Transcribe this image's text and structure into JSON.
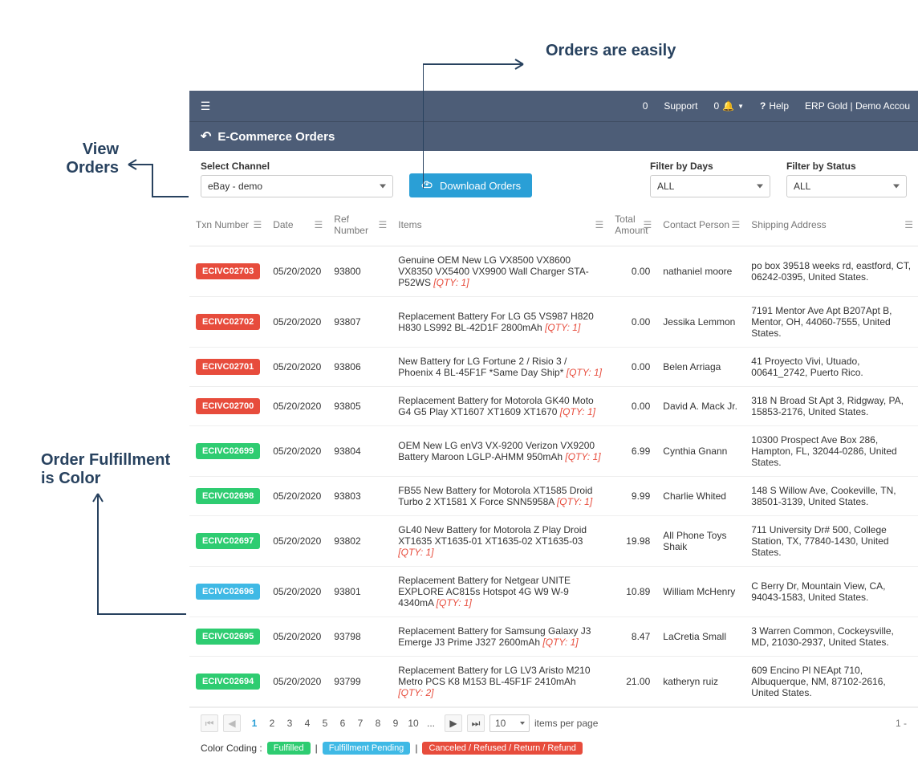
{
  "annotations": {
    "orders_easily": "Orders are easily",
    "view_orders_l1": "View",
    "view_orders_l2": "Orders",
    "order_fulfillment_l1": "Order Fulfillment",
    "order_fulfillment_l2": "is Color"
  },
  "topbar": {
    "count1": "0",
    "support": "Support",
    "count2": "0",
    "help": "Help",
    "account": "ERP Gold | Demo Accou"
  },
  "page": {
    "title": "E-Commerce Orders"
  },
  "filters": {
    "channel_label": "Select Channel",
    "channel_value": "eBay - demo",
    "download_label": "Download Orders",
    "days_label": "Filter by Days",
    "days_value": "ALL",
    "status_label": "Filter by Status",
    "status_value": "ALL"
  },
  "headers": {
    "txn": "Txn Number",
    "date": "Date",
    "ref": "Ref Number",
    "items": "Items",
    "amount": "Total Amount",
    "contact": "Contact Person",
    "addr": "Shipping Address"
  },
  "rows": [
    {
      "txn": "ECIVC02703",
      "status": "red",
      "date": "05/20/2020",
      "ref": "93800",
      "item": "Genuine OEM New LG VX8500 VX8600 VX8350 VX5400 VX9900 Wall Charger STA-P52WS",
      "qty": "[QTY: 1]",
      "amount": "0.00",
      "contact": "nathaniel moore",
      "addr": "po box 39518 weeks rd, eastford, CT, 06242-0395, United States."
    },
    {
      "txn": "ECIVC02702",
      "status": "red",
      "date": "05/20/2020",
      "ref": "93807",
      "item": "Replacement Battery For LG G5 VS987 H820 H830 LS992 BL-42D1F 2800mAh",
      "qty": "[QTY: 1]",
      "amount": "0.00",
      "contact": "Jessika Lemmon",
      "addr": "7191 Mentor Ave Apt B207Apt B, Mentor, OH, 44060-7555, United States."
    },
    {
      "txn": "ECIVC02701",
      "status": "red",
      "date": "05/20/2020",
      "ref": "93806",
      "item": "New Battery for LG Fortune 2 / Risio 3 / Phoenix 4 BL-45F1F *Same Day Ship*",
      "qty": "[QTY: 1]",
      "amount": "0.00",
      "contact": "Belen Arriaga",
      "addr": "41 Proyecto Vivi, Utuado, 00641_2742, Puerto Rico."
    },
    {
      "txn": "ECIVC02700",
      "status": "red",
      "date": "05/20/2020",
      "ref": "93805",
      "item": "Replacement Battery for Motorola GK40 Moto G4 G5 Play XT1607 XT1609 XT1670",
      "qty": "[QTY: 1]",
      "amount": "0.00",
      "contact": "David A. Mack Jr.",
      "addr": "318 N Broad St Apt 3, Ridgway, PA, 15853-2176, United States."
    },
    {
      "txn": "ECIVC02699",
      "status": "green",
      "date": "05/20/2020",
      "ref": "93804",
      "item": "OEM New LG enV3 VX-9200 Verizon VX9200 Battery Maroon LGLP-AHMM 950mAh",
      "qty": "[QTY: 1]",
      "amount": "6.99",
      "contact": "Cynthia Gnann",
      "addr": "10300 Prospect Ave Box 286, Hampton, FL, 32044-0286, United States."
    },
    {
      "txn": "ECIVC02698",
      "status": "green",
      "date": "05/20/2020",
      "ref": "93803",
      "item": "FB55 New Battery for Motorola XT1585 Droid Turbo 2 XT1581 X Force SNN5958A",
      "qty": "[QTY: 1]",
      "amount": "9.99",
      "contact": "Charlie Whited",
      "addr": "148 S Willow Ave, Cookeville, TN, 38501-3139, United States."
    },
    {
      "txn": "ECIVC02697",
      "status": "green",
      "date": "05/20/2020",
      "ref": "93802",
      "item": "GL40 New Battery for Motorola Z Play Droid XT1635 XT1635-01 XT1635-02 XT1635-03",
      "qty": "[QTY: 1]",
      "amount": "19.98",
      "contact": "All Phone Toys Shaik",
      "addr": "711 University Dr# 500, College Station, TX, 77840-1430, United States."
    },
    {
      "txn": "ECIVC02696",
      "status": "blue",
      "date": "05/20/2020",
      "ref": "93801",
      "item": "Replacement Battery for Netgear UNITE EXPLORE AC815s Hotspot 4G W9 W-9 4340mA",
      "qty": "[QTY: 1]",
      "amount": "10.89",
      "contact": "William McHenry",
      "addr": "C Berry Dr, Mountain View, CA, 94043-1583, United States."
    },
    {
      "txn": "ECIVC02695",
      "status": "green",
      "date": "05/20/2020",
      "ref": "93798",
      "item": "Replacement Battery for Samsung Galaxy J3 Emerge J3 Prime J327 2600mAh",
      "qty": "[QTY: 1]",
      "amount": "8.47",
      "contact": "LaCretia Small",
      "addr": "3 Warren Common, Cockeysville, MD, 21030-2937, United States."
    },
    {
      "txn": "ECIVC02694",
      "status": "green",
      "date": "05/20/2020",
      "ref": "93799",
      "item": "Replacement Battery for LG LV3 Aristo M210 Metro PCS K8 M153 BL-45F1F 2410mAh",
      "qty": "[QTY: 2]",
      "amount": "21.00",
      "contact": "katheryn ruiz",
      "addr": "609 Encino Pl NEApt 710, Albuquerque, NM, 87102-2616, United States."
    }
  ],
  "pager": {
    "pages": [
      "1",
      "2",
      "3",
      "4",
      "5",
      "6",
      "7",
      "8",
      "9",
      "10",
      "..."
    ],
    "per_page": "10",
    "per_page_label": "items per page",
    "range": "1 -"
  },
  "legend": {
    "label": "Color Coding :",
    "fulfilled": "Fulfilled",
    "pending": "Fulfillment Pending",
    "cancel": "Canceled / Refused / Return / Refund",
    "sep": "|"
  }
}
